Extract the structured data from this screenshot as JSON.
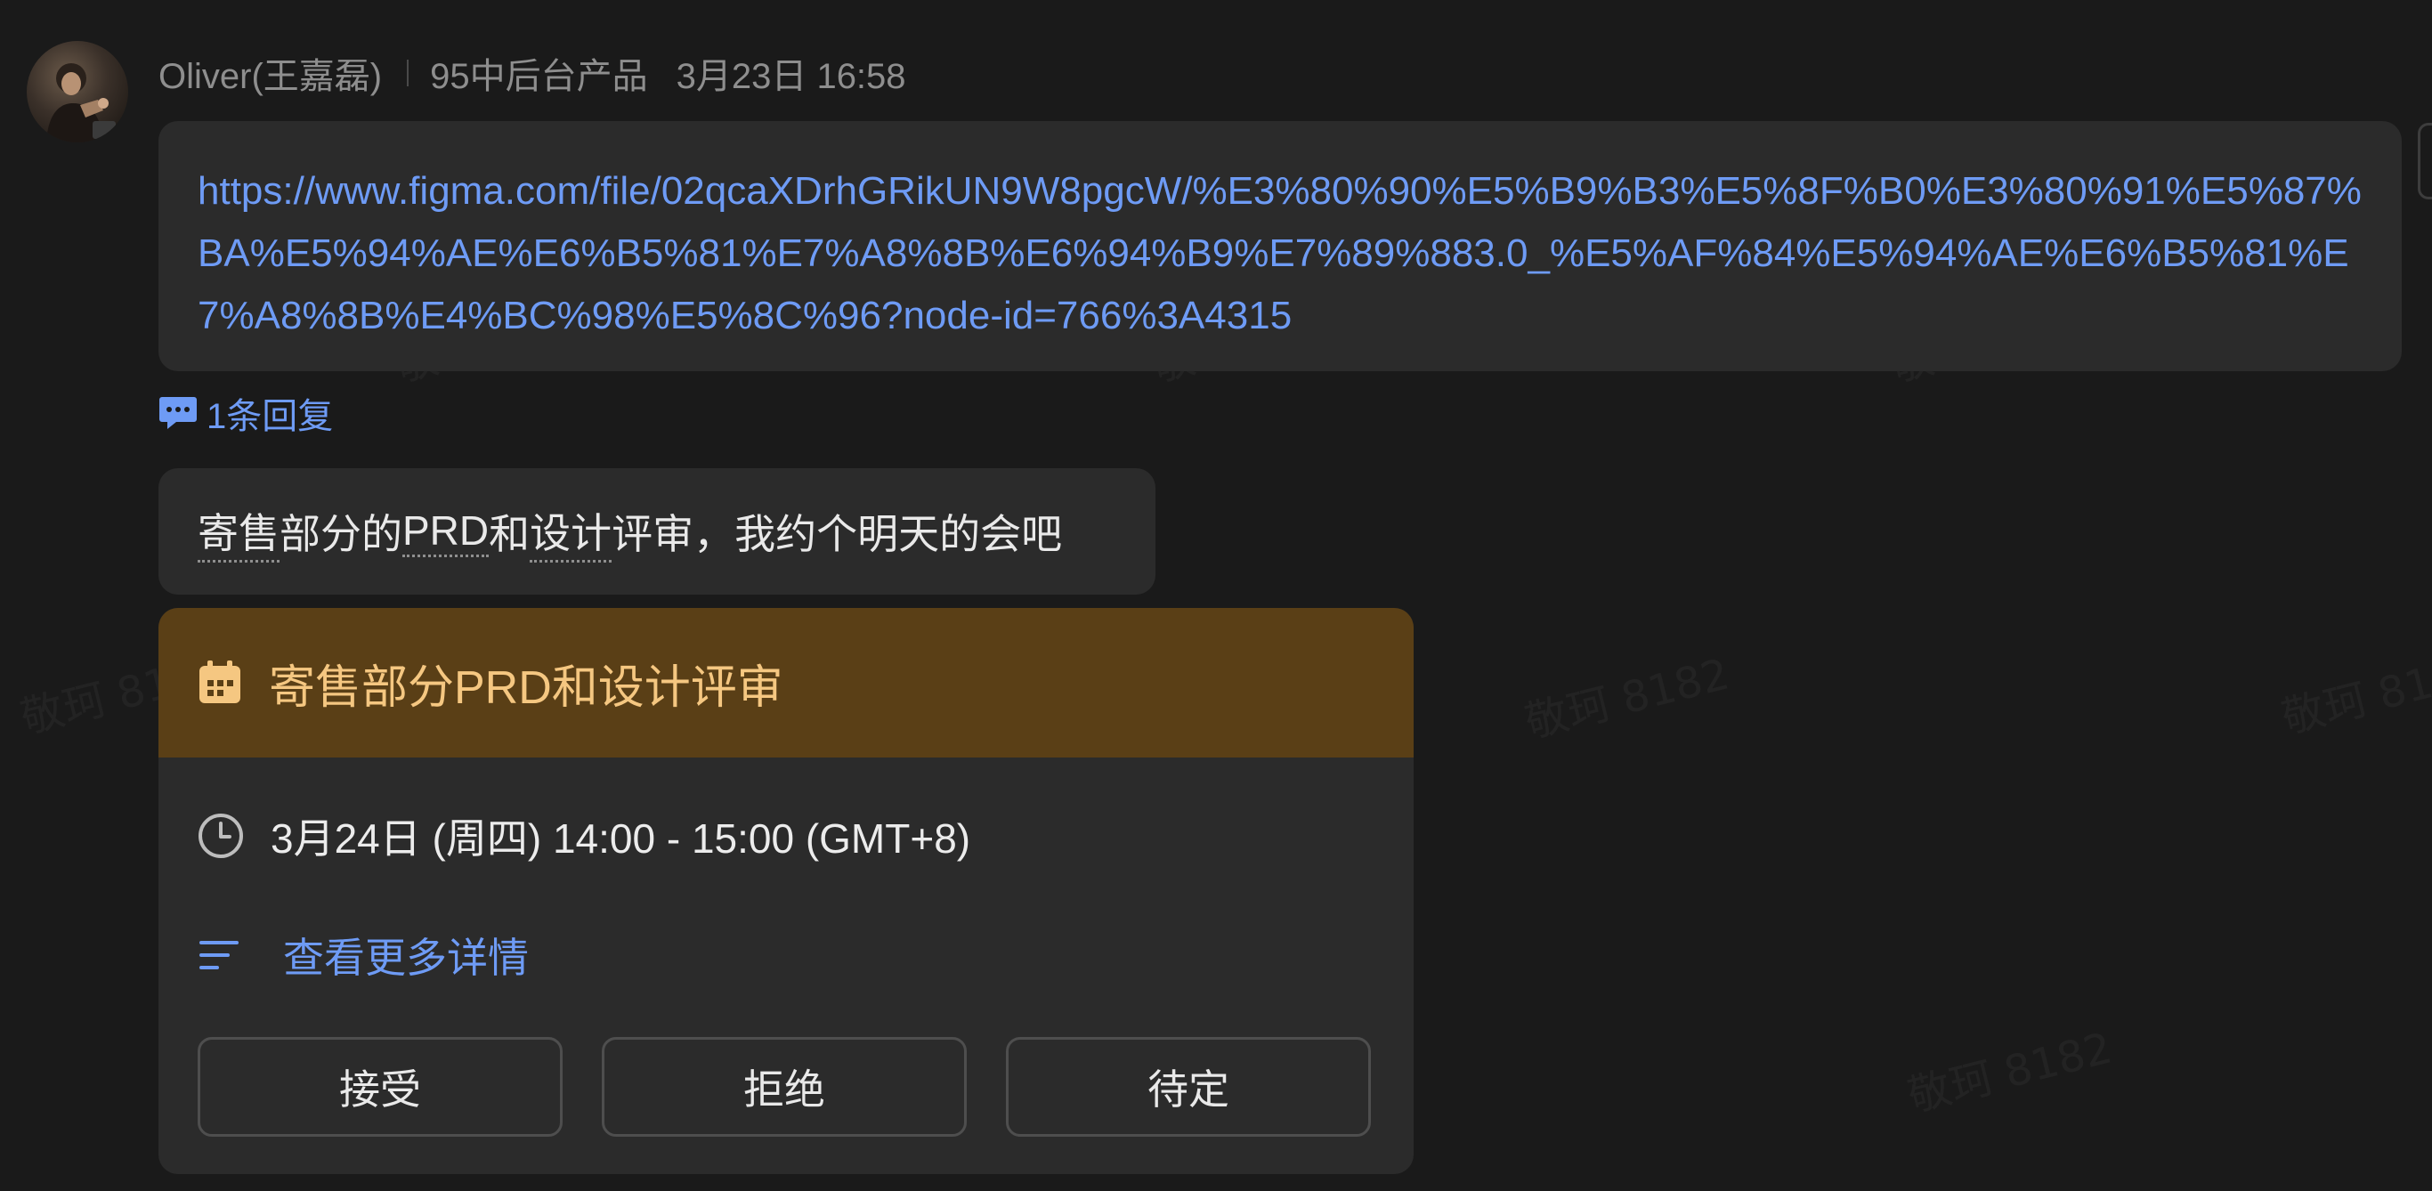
{
  "message": {
    "sender_name": "Oliver(王嘉磊)",
    "sender_dept": "95中后台产品",
    "timestamp": "3月23日 16:58",
    "link_url": "https://www.figma.com/file/02qcaXDrhGRikUN9W8pgcW/%E3%80%90%E5%B9%B3%E5%8F%B0%E3%80%91%E5%87%BA%E5%94%AE%E6%B5%81%E7%A8%8B%E6%94%B9%E7%89%883.0_%E5%AF%84%E5%94%AE%E6%B5%81%E7%A8%8B%E4%BC%98%E5%8C%96?node-id=766%3A4315",
    "reply_count_label": "1条回复",
    "text_parts": [
      "寄售",
      "部分的",
      "PRD",
      "和",
      "设计",
      "评审，我约个明天的会吧"
    ]
  },
  "event_card": {
    "title": "寄售部分PRD和设计评审",
    "time": "3月24日 (周四) 14:00 - 15:00 (GMT+8)",
    "details_label": "查看更多详情",
    "buttons": {
      "accept": "接受",
      "decline": "拒绝",
      "tentative": "待定"
    },
    "header_color": "#5a3f16",
    "title_color": "#f5c781"
  },
  "watermark": "敬珂 8182",
  "colors": {
    "background": "#1a1a1a",
    "bubble": "#2b2b2b",
    "link": "#6e9bf5"
  },
  "icons": {
    "reply": "reply-bubble-icon",
    "calendar": "calendar-icon",
    "clock": "clock-icon",
    "details": "list-lines-icon"
  }
}
